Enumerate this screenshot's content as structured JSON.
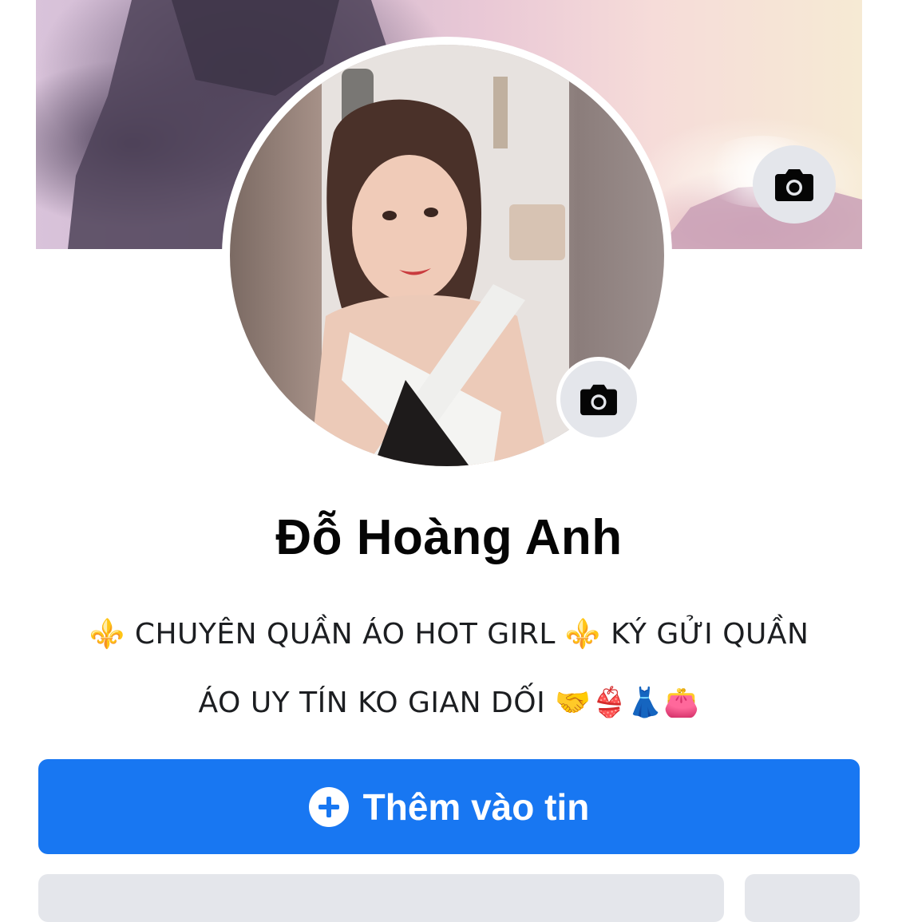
{
  "profile": {
    "name": "Đỗ Hoàng Anh",
    "bio_line1": "⚜️ CHUYÊN QUẦN ÁO HOT GIRL ⚜️ KÝ GỬI QUẦN",
    "bio_line2": "ÁO UY TÍN KO GIAN DỐI 🤝👙👗👛"
  },
  "actions": {
    "add_story_label": "Thêm vào tin"
  },
  "icons": {
    "cover_camera": "camera-icon",
    "avatar_camera": "camera-icon",
    "add_story": "plus-circle-icon"
  },
  "colors": {
    "primary": "#1877f2",
    "secondary_button": "#e4e6eb",
    "text": "#050505"
  }
}
